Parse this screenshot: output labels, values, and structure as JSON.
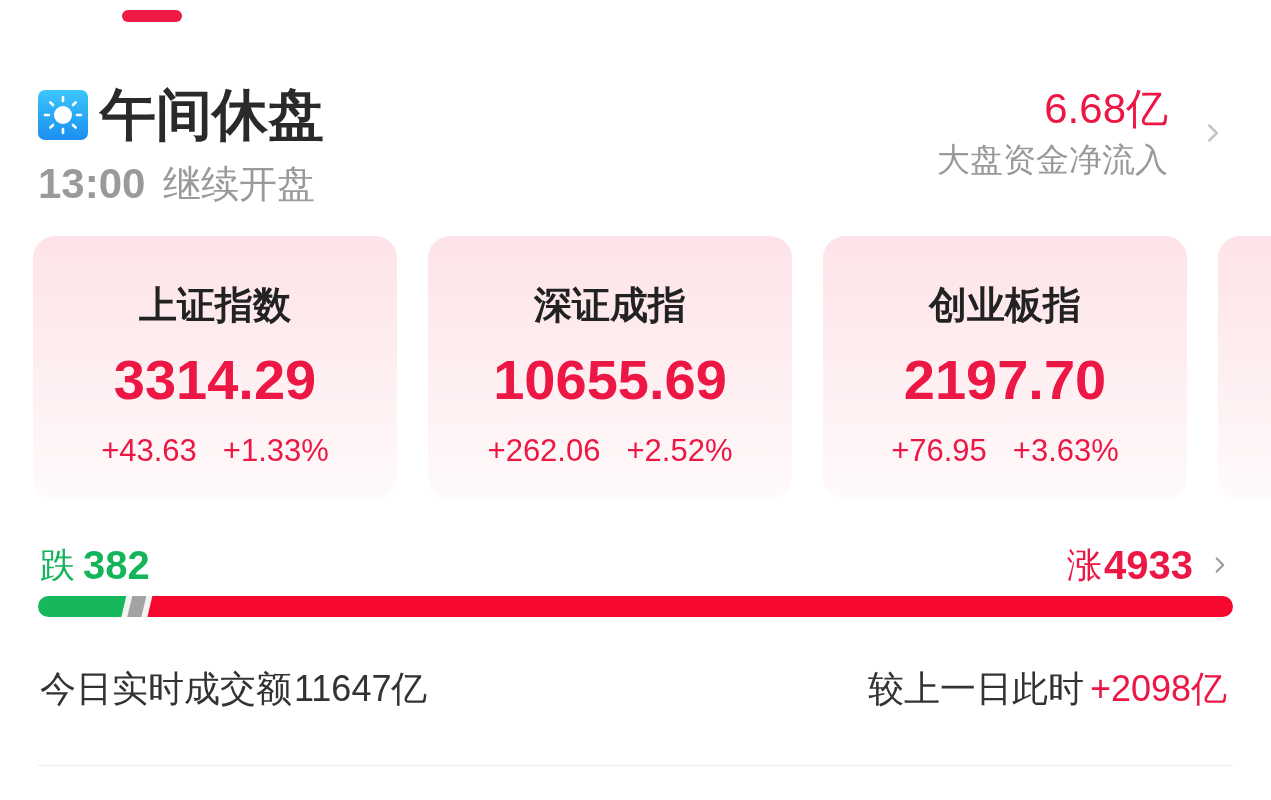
{
  "market_status": {
    "title": "午间休盘",
    "resume_time": "13:00",
    "resume_text": "继续开盘"
  },
  "net_inflow": {
    "value": "6.68亿",
    "label": "大盘资金净流入"
  },
  "index_cards": [
    {
      "name": "上证指数",
      "value": "3314.29",
      "change": "+43.63",
      "change_pct": "+1.33%"
    },
    {
      "name": "深证成指",
      "value": "10655.69",
      "change": "+262.06",
      "change_pct": "+2.52%"
    },
    {
      "name": "创业板指",
      "value": "2197.70",
      "change": "+76.95",
      "change_pct": "+3.63%"
    }
  ],
  "breadth": {
    "down_label": "跌",
    "down_count": "382",
    "up_label": "涨",
    "up_count": "4933",
    "bar_segments": [
      {
        "kind": "down",
        "level": 0.074
      },
      {
        "kind": "flat",
        "level": 0.016
      },
      {
        "kind": "up",
        "level": 0.91
      }
    ]
  },
  "turnover": {
    "label": "今日实时成交额",
    "value": "11647亿",
    "compare_label": "较上一日此时",
    "compare_value": "+2098亿"
  }
}
